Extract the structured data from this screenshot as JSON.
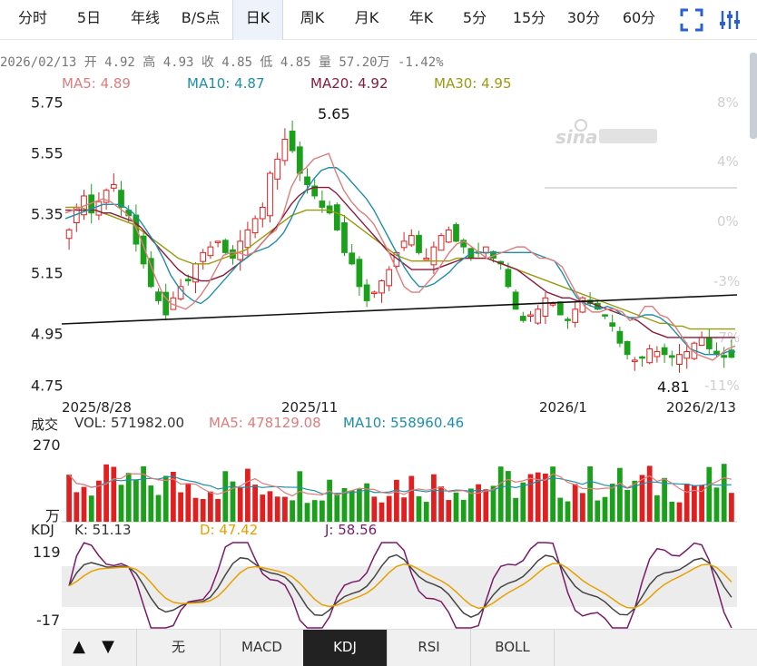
{
  "tabs": [
    {
      "label": "分时",
      "active": false
    },
    {
      "label": "5日",
      "active": false
    },
    {
      "label": "年线",
      "active": false
    },
    {
      "label": "B/S点",
      "active": false
    },
    {
      "label": "日K",
      "active": true
    },
    {
      "label": "周K",
      "active": false
    },
    {
      "label": "月K",
      "active": false
    },
    {
      "label": "年K",
      "active": false
    },
    {
      "label": "5分",
      "active": false
    },
    {
      "label": "15分",
      "active": false
    },
    {
      "label": "30分",
      "active": false
    },
    {
      "label": "60分",
      "active": false
    }
  ],
  "toolbar_icons": [
    "fullscreen-icon",
    "settings-icon"
  ],
  "info_bar": "2026/02/13 开 4.92 高 4.93 收 4.85 低 4.85 量 57.20万 -1.42%",
  "ma": [
    {
      "label": "MA5: 4.89",
      "color": "#e07c7c"
    },
    {
      "label": "MA10: 4.87",
      "color": "#1e8fa8"
    },
    {
      "label": "MA20: 4.92",
      "color": "#8b1a3a"
    },
    {
      "label": "MA30: 4.95",
      "color": "#9a9a10"
    }
  ],
  "price_axis": {
    "ticks": [
      "5.75",
      "5.55",
      "5.35",
      "5.15",
      "4.95",
      "4.75"
    ],
    "range": [
      4.75,
      5.75
    ]
  },
  "pct_axis": [
    "8%",
    "4%",
    "0%",
    "-3%",
    "-7%",
    "-11%"
  ],
  "date_axis": [
    "2025/8/28",
    "2025/11",
    "2026/1",
    "2026/2/13"
  ],
  "high_marker": "5.65",
  "low_marker": "4.81",
  "volume_header": {
    "title": "成交",
    "items": [
      {
        "label": "VOL: 571982.00",
        "color": "#333333"
      },
      {
        "label": "MA5: 478129.08",
        "color": "#e07c7c"
      },
      {
        "label": "MA10: 558960.46",
        "color": "#1e8fa8"
      }
    ],
    "top_value": "270",
    "unit": "万"
  },
  "kdj_header": {
    "title": "KDJ",
    "items": [
      {
        "label": "K: 51.13",
        "color": "#333333"
      },
      {
        "label": "D: 47.42",
        "color": "#e8a000"
      },
      {
        "label": "J: 58.56",
        "color": "#7a1a6a"
      }
    ],
    "top_value": "119",
    "bottom_value": "-17"
  },
  "bottom_nav": {
    "prev_arrow": "▲",
    "next_arrow": "▼",
    "buttons": [
      {
        "label": "无",
        "active": false
      },
      {
        "label": "MACD",
        "active": false
      },
      {
        "label": "KDJ",
        "active": true
      },
      {
        "label": "RSI",
        "active": false
      },
      {
        "label": "BOLL",
        "active": false
      }
    ]
  },
  "colors": {
    "up": "#e02020",
    "down": "#1aa01a",
    "ma5": "#e07c7c",
    "ma10": "#1e8fa8",
    "ma20": "#8b1a3a",
    "ma30": "#9a9a10",
    "k": "#444444",
    "d": "#e8a000",
    "j": "#7a1a6a"
  },
  "chart_data": {
    "type": "candlestick",
    "ma5": [
      5.36,
      5.37,
      5.38,
      5.39,
      5.4,
      5.41,
      5.4,
      5.38,
      5.36,
      5.33,
      5.27,
      5.2,
      5.13,
      5.07,
      5.04,
      5.03,
      5.02,
      5.04,
      5.07,
      5.11,
      5.16,
      5.21,
      5.22,
      5.22,
      5.21,
      5.22,
      5.25,
      5.28,
      5.3,
      5.36,
      5.45,
      5.5,
      5.52,
      5.55,
      5.56,
      5.57,
      5.5,
      5.44,
      5.4,
      5.37,
      5.35,
      5.32,
      5.27,
      5.22,
      5.16,
      5.1,
      5.08,
      5.08,
      5.11,
      5.14,
      5.18,
      5.22,
      5.25,
      5.26,
      5.24,
      5.22,
      5.2,
      5.21,
      5.22,
      5.23,
      5.24,
      5.24,
      5.22,
      5.2,
      5.2,
      5.19,
      5.17,
      5.12,
      5.07,
      5.03,
      5.01,
      5.01,
      5.02,
      5.02,
      5.01,
      4.98,
      4.99,
      5.03,
      5.03,
      5.0,
      4.99,
      4.96,
      4.92,
      4.88,
      4.86,
      4.85,
      4.84,
      4.86,
      4.88,
      4.89
    ],
    "ma10": [
      5.34,
      5.35,
      5.36,
      5.37,
      5.38,
      5.39,
      5.39,
      5.39,
      5.38,
      5.36,
      5.33,
      5.29,
      5.25,
      5.2,
      5.14,
      5.1,
      5.07,
      5.05,
      5.04,
      5.06,
      5.09,
      5.12,
      5.15,
      5.18,
      5.2,
      5.22,
      5.23,
      5.24,
      5.26,
      5.29,
      5.34,
      5.4,
      5.44,
      5.48,
      5.51,
      5.52,
      5.52,
      5.5,
      5.47,
      5.44,
      5.41,
      5.37,
      5.32,
      5.27,
      5.22,
      5.17,
      5.13,
      5.1,
      5.1,
      5.11,
      5.13,
      5.15,
      5.18,
      5.2,
      5.22,
      5.22,
      5.22,
      5.22,
      5.22,
      5.22,
      5.22,
      5.22,
      5.22,
      5.21,
      5.2,
      5.19,
      5.15,
      5.1,
      5.06,
      5.04,
      5.03,
      5.02,
      5.03,
      5.02,
      5.0,
      4.99,
      4.99,
      5.0,
      5.0,
      4.99,
      4.97,
      4.94,
      4.91,
      4.88,
      4.87,
      4.86,
      4.86,
      4.86,
      4.87,
      4.87
    ],
    "ma20": [
      5.37,
      5.37,
      5.37,
      5.37,
      5.37,
      5.36,
      5.36,
      5.35,
      5.34,
      5.33,
      5.31,
      5.28,
      5.25,
      5.22,
      5.19,
      5.16,
      5.14,
      5.13,
      5.12,
      5.12,
      5.13,
      5.14,
      5.16,
      5.18,
      5.2,
      5.22,
      5.25,
      5.28,
      5.31,
      5.35,
      5.39,
      5.42,
      5.44,
      5.45,
      5.45,
      5.45,
      5.43,
      5.4,
      5.37,
      5.34,
      5.31,
      5.28,
      5.25,
      5.22,
      5.2,
      5.18,
      5.16,
      5.16,
      5.16,
      5.16,
      5.17,
      5.18,
      5.19,
      5.2,
      5.2,
      5.2,
      5.2,
      5.19,
      5.18,
      5.17,
      5.16,
      5.14,
      5.12,
      5.1,
      5.08,
      5.07,
      5.06,
      5.06,
      5.05,
      5.05,
      5.04,
      5.03,
      5.02,
      5.01,
      5.0,
      4.99,
      4.98,
      4.96,
      4.94,
      4.93,
      4.92,
      4.92,
      4.92,
      4.92,
      4.92,
      4.92,
      4.92,
      4.92,
      4.92,
      4.92
    ],
    "ma30": [
      5.38,
      5.38,
      5.38,
      5.37,
      5.37,
      5.36,
      5.35,
      5.34,
      5.33,
      5.32,
      5.3,
      5.28,
      5.26,
      5.24,
      5.22,
      5.2,
      5.19,
      5.18,
      5.18,
      5.18,
      5.19,
      5.2,
      5.21,
      5.22,
      5.23,
      5.25,
      5.27,
      5.29,
      5.31,
      5.33,
      5.35,
      5.36,
      5.37,
      5.37,
      5.37,
      5.37,
      5.36,
      5.35,
      5.33,
      5.31,
      5.29,
      5.27,
      5.25,
      5.23,
      5.21,
      5.2,
      5.19,
      5.19,
      5.19,
      5.19,
      5.19,
      5.19,
      5.2,
      5.2,
      5.2,
      5.2,
      5.2,
      5.19,
      5.18,
      5.17,
      5.16,
      5.15,
      5.14,
      5.13,
      5.12,
      5.11,
      5.1,
      5.09,
      5.08,
      5.07,
      5.06,
      5.05,
      5.04,
      5.03,
      5.02,
      5.01,
      5.0,
      4.99,
      4.98,
      4.97,
      4.97,
      4.96,
      4.96,
      4.95,
      4.95,
      4.95,
      4.95,
      4.95,
      4.95,
      4.95
    ],
    "candles_sample_close": [
      5.3,
      5.38,
      5.42,
      5.36,
      5.4,
      5.44,
      5.46,
      5.38,
      5.35,
      5.25,
      5.18,
      5.1,
      5.05,
      5.0,
      5.06,
      5.1,
      5.12,
      5.18,
      5.22,
      5.24,
      5.26,
      5.22,
      5.2,
      5.26,
      5.3,
      5.34,
      5.38,
      5.5,
      5.55,
      5.62,
      5.58,
      5.5,
      5.46,
      5.42,
      5.38,
      5.36,
      5.3,
      5.22,
      5.18,
      5.1,
      5.05,
      5.08,
      5.12,
      5.16,
      5.22,
      5.26,
      5.28,
      5.22,
      5.2,
      5.24,
      5.28,
      5.3,
      5.26,
      5.24,
      5.2,
      5.22,
      5.24,
      5.2,
      5.18,
      5.1,
      5.02,
      4.98,
      5.0,
      5.02,
      5.06,
      5.04,
      5.0,
      4.98,
      5.02,
      5.06,
      5.04,
      5.02,
      5.0,
      4.96,
      4.9,
      4.86,
      4.84,
      4.85,
      4.88,
      4.87,
      4.86,
      4.85,
      4.86,
      4.87,
      4.9,
      4.92,
      4.88,
      4.86,
      4.85,
      4.85
    ],
    "ylim": [
      4.75,
      5.75
    ],
    "xlabel": "",
    "ylabel": ""
  }
}
